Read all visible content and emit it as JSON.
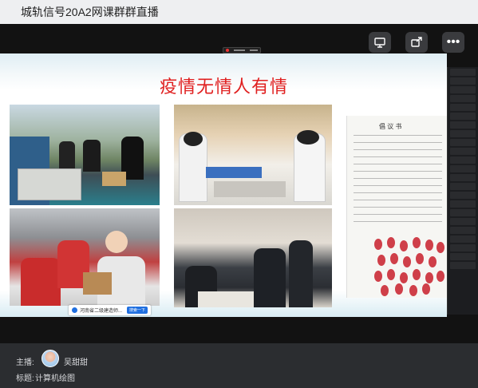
{
  "window": {
    "title": "城轨信号20A2网课群群直播"
  },
  "slide": {
    "heading": "疫情无情人有情",
    "letter_title": "倡 议 书"
  },
  "toast": {
    "text": "河南省二级建造师...",
    "button": "搜索一下"
  },
  "info": {
    "host_label": "主播:",
    "host_name": "吴甜甜",
    "topic_label": "标题:",
    "topic": "计算机绘图"
  },
  "icons": {
    "share_screen": "share-screen-icon",
    "popout": "popout-icon",
    "more": "more-icon"
  },
  "colors": {
    "heading_red": "#e02020",
    "accent_blue": "#1f6fe0"
  }
}
